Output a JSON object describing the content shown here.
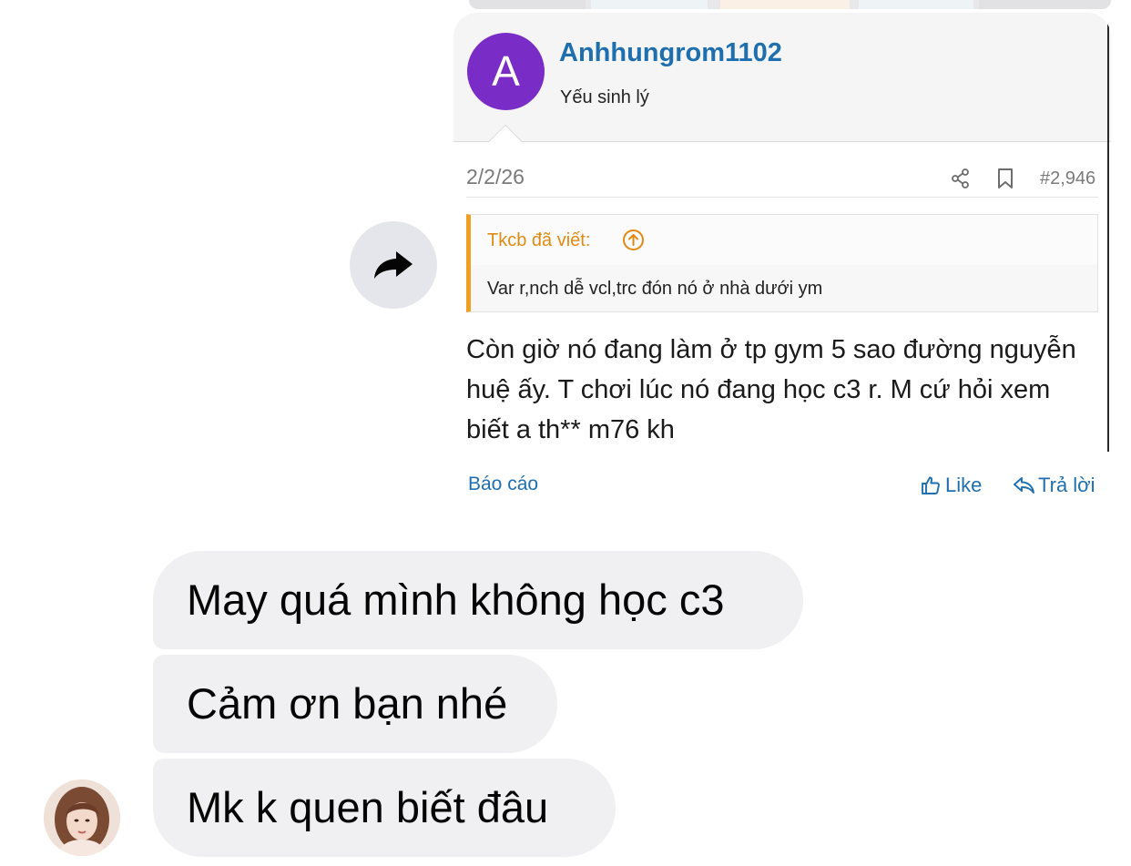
{
  "shared_post": {
    "author_initial": "A",
    "author_name": "Anhhungrom1102",
    "author_title": "Yếu sinh lý",
    "date": "2/2/26",
    "post_number": "#2,946",
    "quote": {
      "author_line": "Tkcb đã viết:",
      "text": "Var r,nch dễ vcl,trc đón nó ở nhà dưới ym"
    },
    "body": "Còn giờ nó đang làm ở tp gym 5 sao đường nguyễn huệ ấy. T chơi lúc nó đang học c3 r. M cứ hỏi xem biết a th** m76 kh",
    "actions": {
      "report": "Báo cáo",
      "like": "Like",
      "reply": "Trả lời"
    },
    "colors": {
      "avatar": "#7a2cc7",
      "username": "#1f6fae",
      "quote_accent": "#f0a020"
    },
    "icons": [
      "share-icon",
      "bookmark-icon",
      "arrow-up-circle-icon",
      "thumbs-up-icon",
      "reply-icon"
    ]
  },
  "forward": {
    "icon": "forward-arrow-icon"
  },
  "messages": [
    {
      "text": "May quá mình không học c3"
    },
    {
      "text": "Cảm ơn bạn nhé"
    },
    {
      "text": "Mk k quen biết đâu"
    }
  ],
  "colors": {
    "bubble_bg": "#f0f0f2",
    "forward_button_bg": "#e4e6eb"
  }
}
